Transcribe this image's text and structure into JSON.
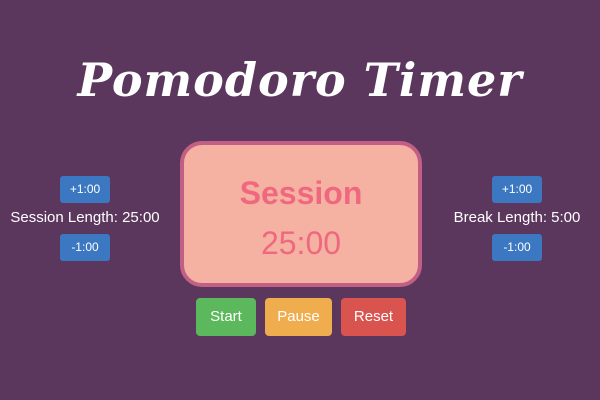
{
  "app": {
    "title": "Pomodoro Timer"
  },
  "session_length": {
    "increment_label": "+1:00",
    "label": "Session Length: 25:00",
    "decrement_label": "-1:00"
  },
  "break_length": {
    "increment_label": "+1:00",
    "label": "Break Length: 5:00",
    "decrement_label": "-1:00"
  },
  "timer": {
    "mode": "Session",
    "time": "25:00"
  },
  "controls": {
    "start_label": "Start",
    "pause_label": "Pause",
    "reset_label": "Reset"
  },
  "colors": {
    "background": "#5b365d",
    "timer_fill": "#f5b1a1",
    "timer_border": "#c25f85",
    "timer_text": "#f0687f",
    "adjust_button": "#3b78c1",
    "start_button": "#5cb85c",
    "pause_button": "#f0ad4e",
    "reset_button": "#d9534f"
  }
}
